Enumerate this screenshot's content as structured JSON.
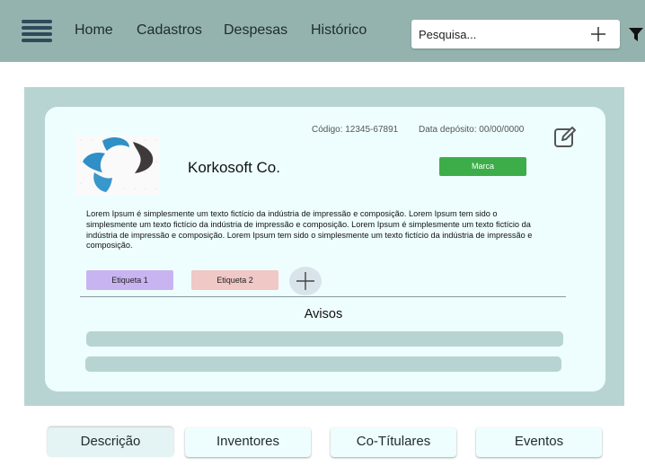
{
  "nav": {
    "items": [
      {
        "label": "Home"
      },
      {
        "label": "Cadastros"
      },
      {
        "label": "Despesas"
      },
      {
        "label": "Histórico"
      }
    ],
    "menu_icon": "hamburger-menu-icon",
    "search": {
      "placeholder": "Pesquisa...",
      "value": "",
      "add_icon": "plus-icon"
    },
    "filter_icon": "filter-icon"
  },
  "record": {
    "company": "Korkosoft Co.",
    "code": "Código: 12345-67891",
    "deposit_date": "Data depósito: 00/00/0000",
    "brand_button": "Marca",
    "edit_icon": "edit-icon",
    "description": "Lorem Ipsum é simplesmente um texto fictício da indústria de impressão e composição. Lorem Ipsum tem sido o simplesmente um texto fictício da indústria de impressão e composição. Lorem Ipsum é simplesmente um texto fictício da indústria de impressão e composição. Lorem Ipsum tem sido o simplesmente um texto fictício da indústria de impressão e composição.",
    "tags": [
      {
        "label": "Etiqueta 1",
        "color": "#c9b4f2"
      },
      {
        "label": "Etiqueta 2",
        "color": "#f0c8c6"
      }
    ],
    "notices_title": "Avisos"
  },
  "tabs": [
    {
      "label": "Descrição",
      "active": true
    },
    {
      "label": "Inventores",
      "active": false
    },
    {
      "label": "Co-Títulares",
      "active": false
    },
    {
      "label": "Eventos",
      "active": false
    }
  ],
  "colors": {
    "topbar": "#94b3ae",
    "panel": "#b7d4d2",
    "card": "#eefefe",
    "brand_button": "#3dad49"
  }
}
